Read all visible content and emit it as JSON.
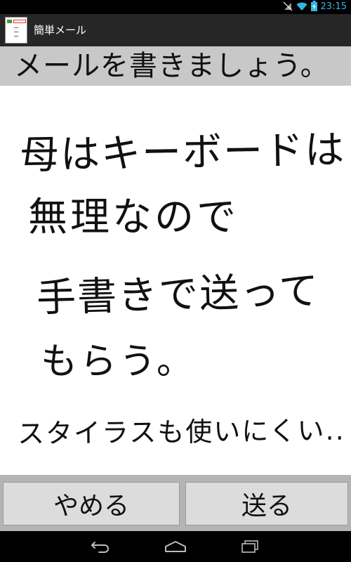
{
  "status_bar": {
    "time": "23:15",
    "icons": [
      "signal-off-icon",
      "wifi-icon",
      "battery-charging-icon"
    ],
    "accent_color": "#33b5e5"
  },
  "action_bar": {
    "title": "簡単メール",
    "icon": "app-icon"
  },
  "prompt": {
    "text": "メールを書きましょう。"
  },
  "canvas": {
    "handwritten_lines": [
      "母はキーボードは",
      "無理なので",
      "手書きで送って",
      "もらう。",
      "スタイラスも使いにくい.."
    ]
  },
  "buttons": {
    "cancel_label": "やめる",
    "send_label": "送る"
  },
  "nav_bar": {
    "icons": [
      "back-icon",
      "home-icon",
      "recent-apps-icon"
    ]
  }
}
